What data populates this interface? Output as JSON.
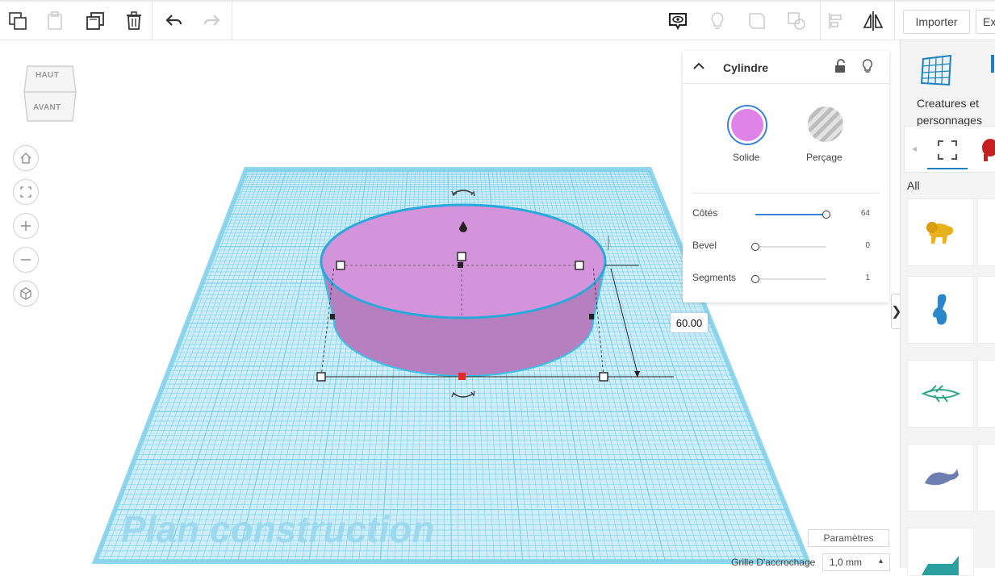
{
  "toolbar": {
    "import_label": "Importer",
    "export_label": "Ex"
  },
  "viewcube": {
    "top_label": "HAUT",
    "front_label": "AVANT"
  },
  "workplane": {
    "watermark": "Plan construction",
    "dimension_value": "60.00"
  },
  "inspector": {
    "title": "Cylindre",
    "solid_label": "Solide",
    "hole_label": "Perçage",
    "solid_color": "#e083e8",
    "sliders": [
      {
        "label": "Côtés",
        "value": "64",
        "fraction": 1.0
      },
      {
        "label": "Bevel",
        "value": "0",
        "fraction": 0.0
      },
      {
        "label": "Segments",
        "value": "1",
        "fraction": 0.0
      }
    ]
  },
  "side_panel": {
    "category_label": "Creatures et personnages",
    "filter_label": "All",
    "items": [
      {
        "icon": "lion-icon",
        "color": "#e8b21c"
      },
      {
        "icon": "dinosaur-icon",
        "color": "#2a86c8"
      },
      {
        "icon": "dragonfly-icon",
        "color": "#2aa88a"
      },
      {
        "icon": "whale-icon",
        "color": "#6c7fb0"
      },
      {
        "icon": "creature-icon",
        "color": "#2aa0a0"
      }
    ]
  },
  "footer": {
    "params_label": "Paramètres",
    "snap_label": "Grille D'accrochage",
    "snap_value": "1,0 mm"
  },
  "colors": {
    "grid_fill": "#cdeefa",
    "grid_line": "#7ecfe8",
    "shape_top": "#d394dc",
    "shape_side": "#b67fc0",
    "accent": "#1f9fd0"
  }
}
